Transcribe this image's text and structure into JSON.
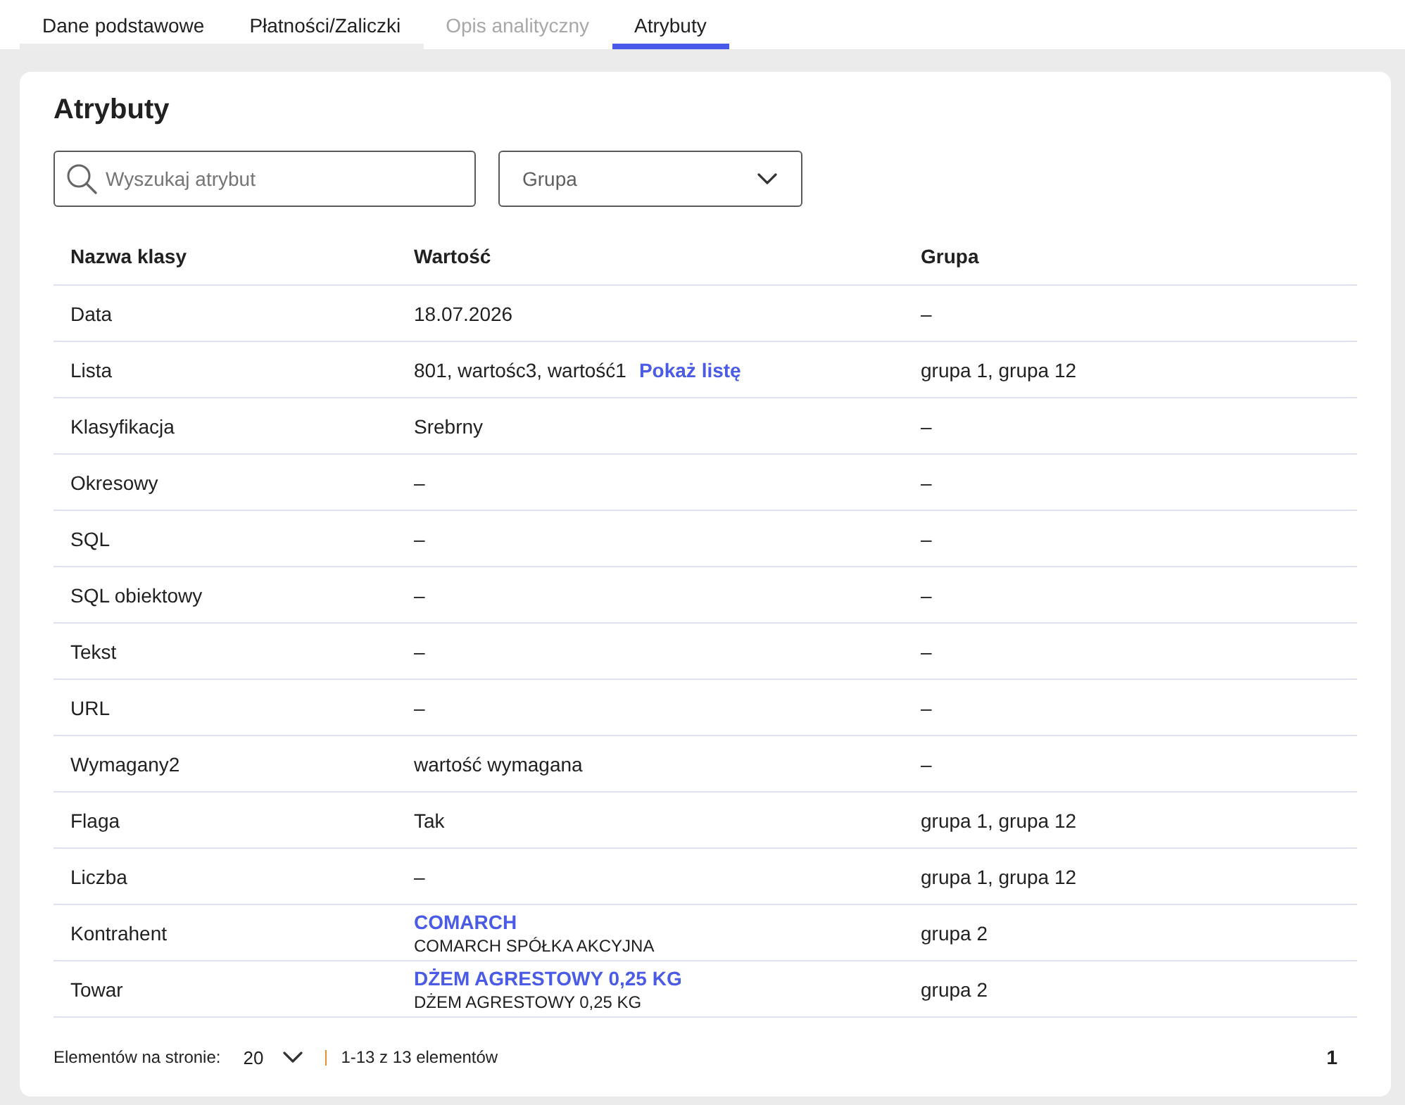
{
  "tabs": [
    {
      "label": "Dane podstawowe",
      "selected": false,
      "disabled": false
    },
    {
      "label": "Płatności/Zaliczki",
      "selected": false,
      "disabled": false
    },
    {
      "label": "Opis analityczny",
      "selected": false,
      "disabled": true
    },
    {
      "label": "Atrybuty",
      "selected": true,
      "disabled": false
    }
  ],
  "panel": {
    "title": "Atrybuty",
    "search": {
      "placeholder": "Wyszukaj atrybut"
    },
    "group_filter": {
      "placeholder": "Grupa"
    },
    "table": {
      "columns": [
        "Nazwa klasy",
        "Wartość",
        "Grupa"
      ],
      "rows": [
        {
          "kind": "text",
          "name": "Data",
          "value": "18.07.2026",
          "group": "–"
        },
        {
          "kind": "list",
          "name": "Lista",
          "value": "801, wartośc3, wartość1",
          "link": "Pokaż listę",
          "group": "grupa 1, grupa 12"
        },
        {
          "kind": "text",
          "name": "Klasyfikacja",
          "value": "Srebrny",
          "group": "–"
        },
        {
          "kind": "text",
          "name": "Okresowy",
          "value": "–",
          "group": "–"
        },
        {
          "kind": "text",
          "name": "SQL",
          "value": "–",
          "group": "–"
        },
        {
          "kind": "text",
          "name": "SQL obiektowy",
          "value": "–",
          "group": "–"
        },
        {
          "kind": "text",
          "name": "Tekst",
          "value": "–",
          "group": "–"
        },
        {
          "kind": "text",
          "name": "URL",
          "value": "–",
          "group": "–"
        },
        {
          "kind": "text",
          "name": "Wymagany2",
          "value": "wartość wymagana",
          "group": "–"
        },
        {
          "kind": "text",
          "name": "Flaga",
          "value": "Tak",
          "group": "grupa 1, grupa 12"
        },
        {
          "kind": "text",
          "name": "Liczba",
          "value": "–",
          "group": "grupa 1, grupa 12"
        },
        {
          "kind": "entity",
          "name": "Kontrahent",
          "code": "COMARCH",
          "full_name": "COMARCH SPÓŁKA AKCYJNA",
          "group": "grupa 2"
        },
        {
          "kind": "entity",
          "name": "Towar",
          "code": "DŻEM AGRESTOWY 0,25 KG",
          "full_name": "DŻEM AGRESTOWY 0,25 KG",
          "group": "grupa 2"
        }
      ]
    },
    "pagination": {
      "page_size_label": "Elementów na stronie:",
      "page_size": "20",
      "range": "1-13 z 13 elementów",
      "pages": [
        {
          "label": "1",
          "selected": true
        }
      ]
    }
  }
}
